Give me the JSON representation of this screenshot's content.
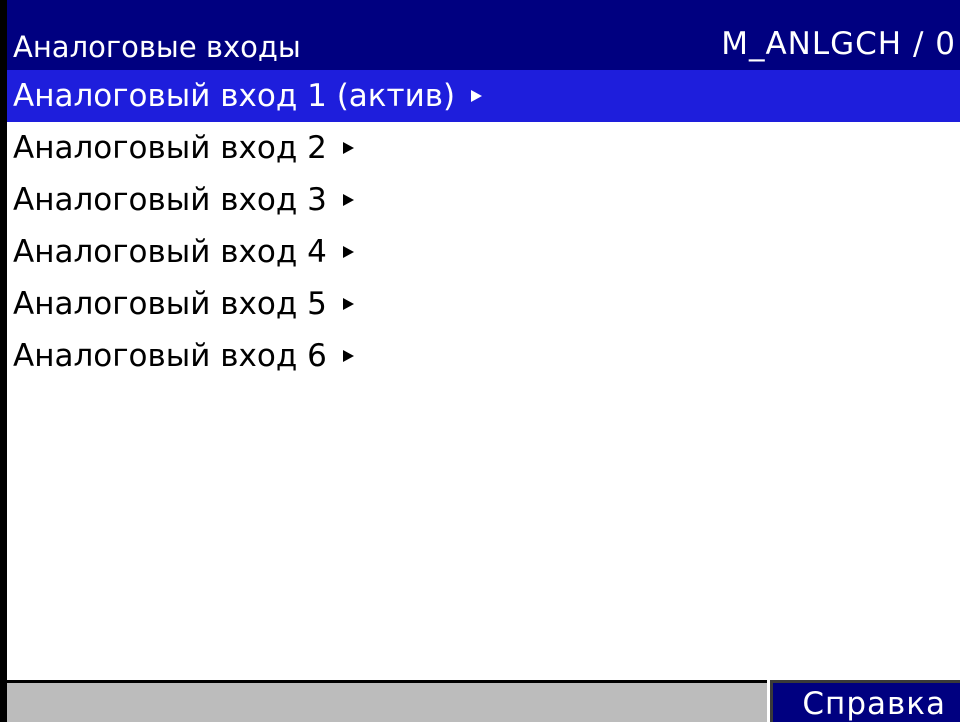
{
  "header": {
    "title": "Аналоговые входы",
    "code": "M_ANLGCH / 0"
  },
  "menu": {
    "items": [
      {
        "label": "Аналоговый вход 1 (актив)",
        "selected": true
      },
      {
        "label": "Аналоговый вход 2",
        "selected": false
      },
      {
        "label": "Аналоговый вход 3",
        "selected": false
      },
      {
        "label": "Аналоговый вход 4",
        "selected": false
      },
      {
        "label": "Аналоговый вход 5",
        "selected": false
      },
      {
        "label": "Аналоговый вход 6",
        "selected": false
      }
    ],
    "item_icon": "submenu-arrow-icon"
  },
  "footer": {
    "status_text": "",
    "help_label": "Справка"
  },
  "colors": {
    "title_bar": "#000080",
    "selection": "#1e1edc",
    "status_bar": "#bcbcbc",
    "text": "#000000",
    "text_inverse": "#ffffff"
  }
}
